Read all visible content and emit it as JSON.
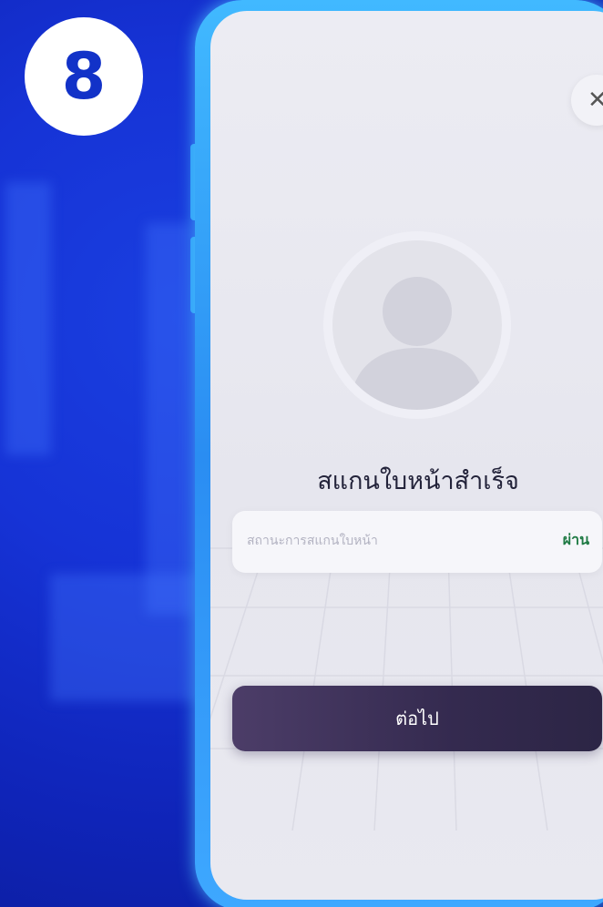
{
  "step_badge": {
    "number": "8"
  },
  "dialog": {
    "close_icon": "close-icon",
    "avatar_icon": "user-silhouette-icon",
    "title": "สแกนใบหน้าสำเร็จ",
    "status": {
      "label": "สถานะการสแกนใบหน้า",
      "value": "ผ่าน"
    },
    "next_button_label": "ต่อไป"
  },
  "colors": {
    "background": "#1633d6",
    "frame": "#2a8df2",
    "status_pass": "#1f7a44",
    "button": "#3a2f57"
  }
}
